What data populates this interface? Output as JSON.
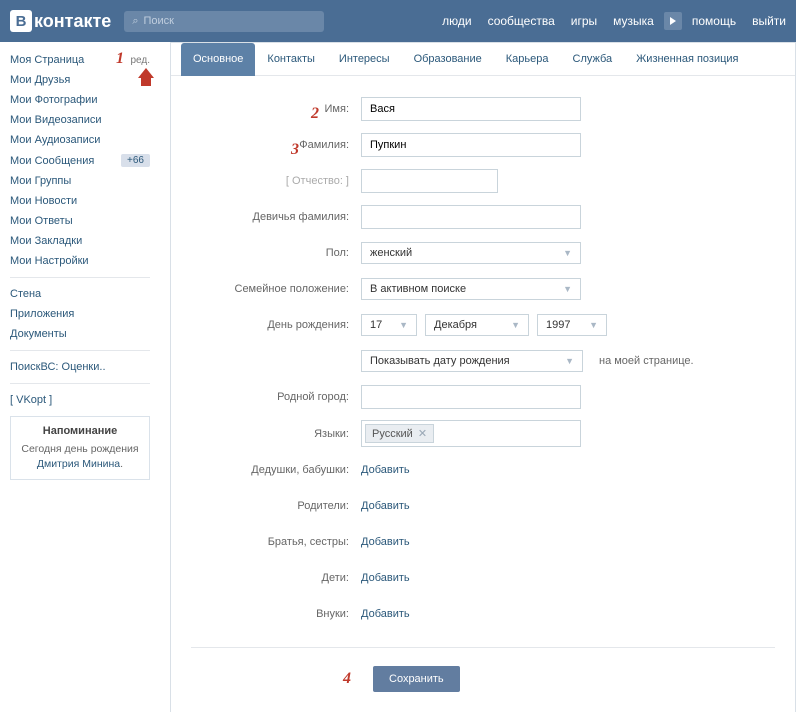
{
  "header": {
    "logo_text": "контакте",
    "search_placeholder": "Поиск",
    "nav": [
      "люди",
      "сообщества",
      "игры",
      "музыка",
      "помощь",
      "выйти"
    ]
  },
  "sidebar": {
    "items": [
      {
        "label": "Моя Страница",
        "edit": "ред."
      },
      {
        "label": "Мои Друзья"
      },
      {
        "label": "Мои Фотографии"
      },
      {
        "label": "Мои Видеозаписи"
      },
      {
        "label": "Мои Аудиозаписи"
      },
      {
        "label": "Мои Сообщения",
        "badge": "+66"
      },
      {
        "label": "Мои Группы"
      },
      {
        "label": "Мои Новости"
      },
      {
        "label": "Мои Ответы"
      },
      {
        "label": "Мои Закладки"
      },
      {
        "label": "Мои Настройки"
      }
    ],
    "group2": [
      {
        "label": "Стена"
      },
      {
        "label": "Приложения"
      },
      {
        "label": "Документы"
      }
    ],
    "group3": [
      {
        "label": "ПоискВС: Оценки.."
      }
    ],
    "group4": [
      {
        "label": "[ VKopt ]"
      }
    ],
    "reminder": {
      "title": "Напоминание",
      "text_pre": "Сегодня ",
      "text_mid": "день рождения ",
      "link": "Дмитрия Минина",
      "dot": "."
    }
  },
  "tabs": [
    "Основное",
    "Контакты",
    "Интересы",
    "Образование",
    "Карьера",
    "Служба",
    "Жизненная позиция"
  ],
  "form": {
    "name_label": "Имя:",
    "name_value": "Вася",
    "surname_label": "Фамилия:",
    "surname_value": "Пупкин",
    "patronymic_label": "[ Отчество: ]",
    "maiden_label": "Девичья фамилия:",
    "gender_label": "Пол:",
    "gender_value": "женский",
    "status_label": "Семейное положение:",
    "status_value": "В активном поиске",
    "bday_label": "День рождения:",
    "bday_day": "17",
    "bday_month": "Декабря",
    "bday_year": "1997",
    "bday_show": "Показывать дату рождения",
    "bday_hint": "на моей странице.",
    "hometown_label": "Родной город:",
    "languages_label": "Языки:",
    "language_tag": "Русский",
    "grandparents_label": "Дедушки, бабушки:",
    "parents_label": "Родители:",
    "siblings_label": "Братья, сестры:",
    "children_label": "Дети:",
    "grandchildren_label": "Внуки:",
    "add_link": "Добавить",
    "save": "Сохранить"
  },
  "annotations": {
    "a1": "1",
    "a2": "2",
    "a3": "3",
    "a4": "4"
  }
}
